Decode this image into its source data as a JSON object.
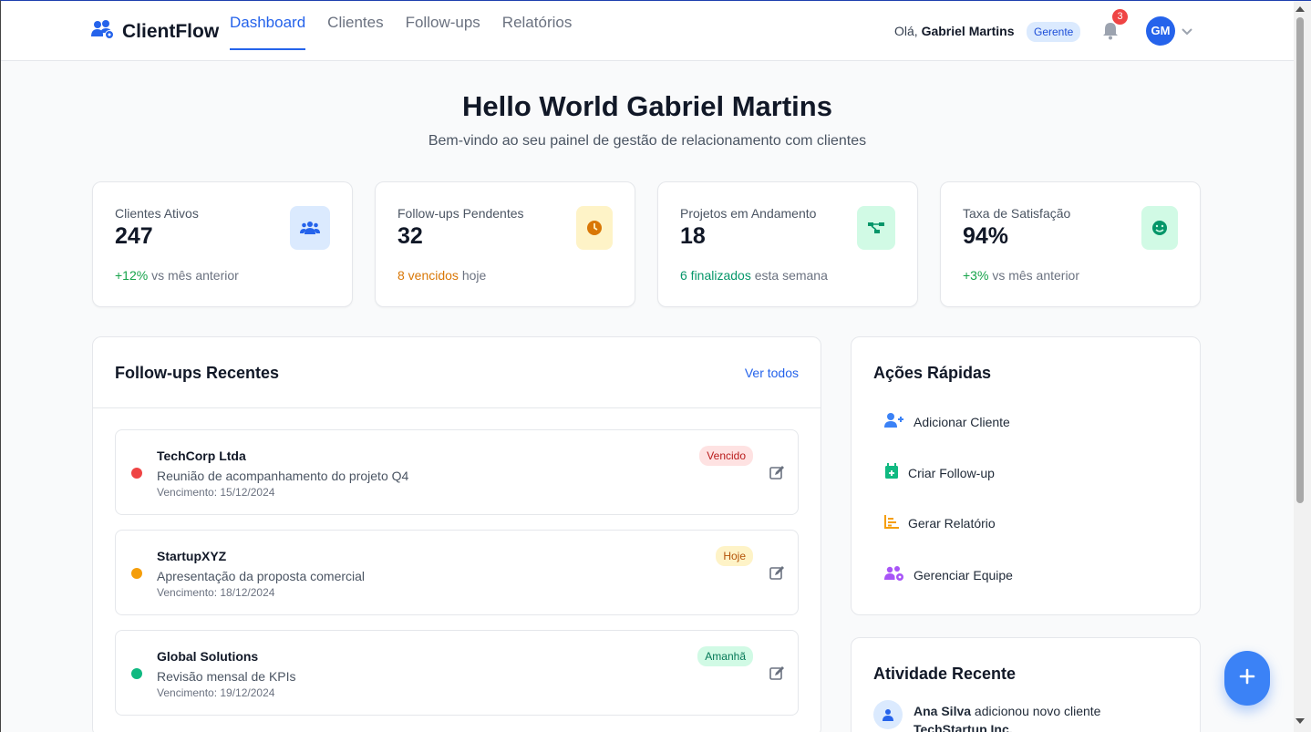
{
  "header": {
    "brand": "ClientFlow",
    "nav": [
      "Dashboard",
      "Clientes",
      "Follow-ups",
      "Relatórios"
    ],
    "greeting_prefix": "Olá,",
    "user_name": "Gabriel Martins",
    "role": "Gerente",
    "notifications": "3",
    "avatar_initials": "GM"
  },
  "hero": {
    "title": "Hello World Gabriel Martins",
    "subtitle": "Bem-vindo ao seu painel de gestão de relacionamento com clientes"
  },
  "stats": [
    {
      "label": "Clientes Ativos",
      "value": "247",
      "highlight": "+12%",
      "rest": "vs mês anterior",
      "icon": "users-icon"
    },
    {
      "label": "Follow-ups Pendentes",
      "value": "32",
      "highlight": "8 vencidos",
      "rest": "hoje",
      "icon": "clock-icon"
    },
    {
      "label": "Projetos em Andamento",
      "value": "18",
      "highlight": "6 finalizados",
      "rest": "esta semana",
      "icon": "project-diagram-icon"
    },
    {
      "label": "Taxa de Satisfação",
      "value": "94%",
      "highlight": "+3%",
      "rest": "vs mês anterior",
      "icon": "smile-icon"
    }
  ],
  "followups": {
    "title": "Follow-ups Recentes",
    "see_all": "Ver todos",
    "items": [
      {
        "name": "TechCorp Ltda",
        "desc": "Reunião de acompanhamento do projeto Q4",
        "due": "Vencimento: 15/12/2024",
        "badge": "Vencido",
        "color": "#ef4444"
      },
      {
        "name": "StartupXYZ",
        "desc": "Apresentação da proposta comercial",
        "due": "Vencimento: 18/12/2024",
        "badge": "Hoje",
        "color": "#f59e0b"
      },
      {
        "name": "Global Solutions",
        "desc": "Revisão mensal de KPIs",
        "due": "Vencimento: 19/12/2024",
        "badge": "Amanhã",
        "color": "#10b981"
      }
    ]
  },
  "quick_actions": {
    "title": "Ações Rápidas",
    "items": [
      {
        "label": "Adicionar Cliente",
        "icon": "user-plus-icon"
      },
      {
        "label": "Criar Follow-up",
        "icon": "calendar-plus-icon"
      },
      {
        "label": "Gerar Relatório",
        "icon": "chart-bar-icon"
      },
      {
        "label": "Gerenciar Equipe",
        "icon": "users-cog-icon"
      }
    ]
  },
  "activity": {
    "title": "Atividade Recente",
    "items": [
      {
        "actor": "Ana Silva",
        "text": "adicionou novo cliente",
        "object": "TechStartup Inc."
      }
    ]
  },
  "colors": {
    "primary": "#2563eb",
    "danger": "#ef4444",
    "warning": "#f59e0b",
    "success": "#10b981"
  }
}
